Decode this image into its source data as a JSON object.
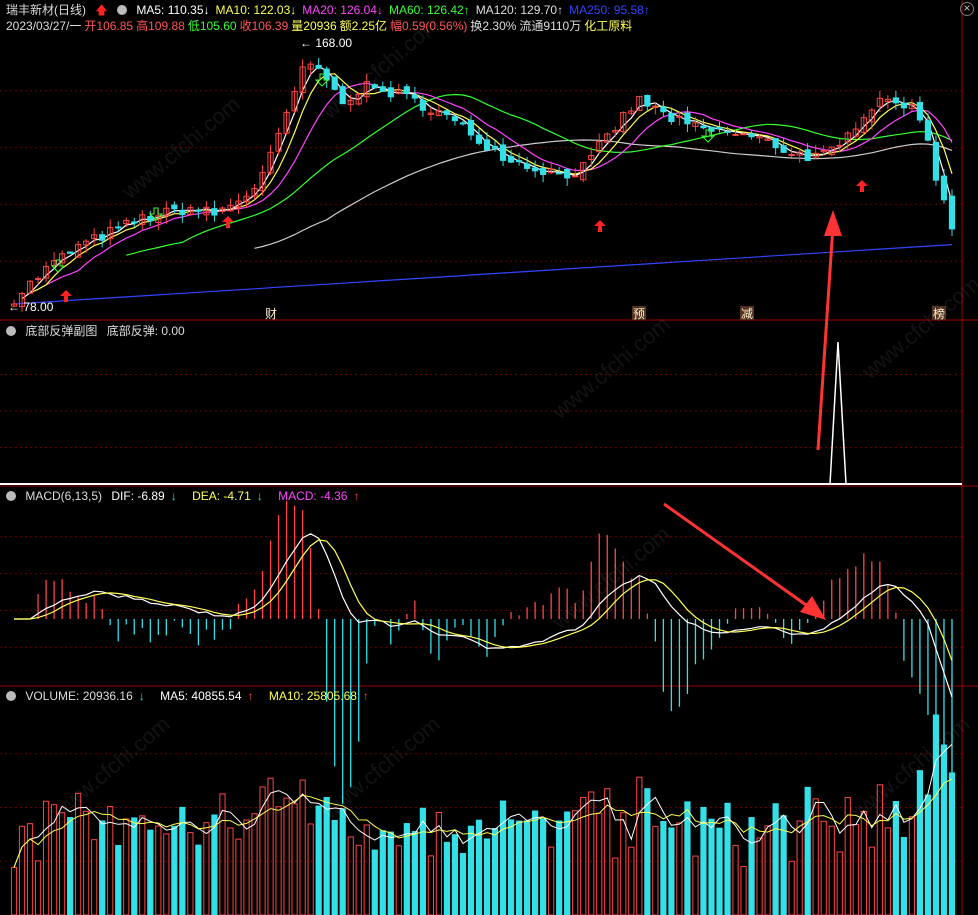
{
  "header": {
    "title": "瑞丰新材(日线)",
    "ma": [
      {
        "label": "MA5: 110.35",
        "color": "#ffffff",
        "dir": "↓"
      },
      {
        "label": "MA10: 122.03",
        "color": "#ffff55",
        "dir": "↓"
      },
      {
        "label": "MA20: 126.04",
        "color": "#ff44ff",
        "dir": "↓"
      },
      {
        "label": "MA60: 126.42",
        "color": "#33ff33",
        "dir": "↑"
      },
      {
        "label": "MA120: 129.70",
        "color": "#dddddd",
        "dir": "↑"
      },
      {
        "label": "MA250: 95.58",
        "color": "#3344ff",
        "dir": "↑"
      }
    ],
    "info": [
      {
        "label": "2023/03/27/一",
        "color": "#dddddd"
      },
      {
        "label": "开106.85",
        "color": "#ff5555"
      },
      {
        "label": "高109.88",
        "color": "#ff5555"
      },
      {
        "label": "低105.60",
        "color": "#33ff33"
      },
      {
        "label": "收106.39",
        "color": "#ff5555"
      },
      {
        "label": "量20936",
        "color": "#ffff55"
      },
      {
        "label": "额2.25亿",
        "color": "#ffff55"
      },
      {
        "label": "幅0.59(0.56%)",
        "color": "#ff5555"
      },
      {
        "label": "换2.30%",
        "color": "#dddddd"
      },
      {
        "label": "流通9110万",
        "color": "#dddddd"
      },
      {
        "label": "化工原料",
        "color": "#ffff55"
      }
    ],
    "high_label": "168.00",
    "low_label": "78.00"
  },
  "markers": [
    "财",
    "预",
    "减",
    "榜"
  ],
  "sub1": {
    "title": "底部反弹副图",
    "value": "底部反弹: 0.00"
  },
  "macd": {
    "title": "MACD(6,13,5)",
    "dif": "DIF: -6.89",
    "dif_dir": "↓",
    "dea": "DEA: -4.71",
    "dea_dir": "↓",
    "macd": "MACD: -4.36",
    "macd_dir": "↑"
  },
  "volume": {
    "title": "VOLUME: 20936.16",
    "title_dir": "↓",
    "ma5": "MA5: 40855.54",
    "ma5_dir": "↑",
    "ma10": "MA10: 25805.68",
    "ma10_dir": "↑"
  },
  "watermark": "www.cfchi.com",
  "colors": {
    "up": "#ff4444",
    "down": "#33e0e8",
    "bg": "#000000",
    "grid": "#5a0000"
  },
  "chart_data": {
    "type": "candlestick",
    "price_range": [
      78,
      168
    ],
    "close_trend": [
      80,
      84,
      88,
      92,
      95,
      98,
      100,
      102,
      104,
      106,
      108,
      109,
      110,
      111,
      112,
      111,
      110,
      112,
      115,
      118,
      125,
      135,
      148,
      160,
      163,
      158,
      150,
      152,
      155,
      154,
      153,
      152,
      150,
      148,
      146,
      143,
      140,
      137,
      134,
      131,
      129,
      127,
      126,
      125,
      124,
      125,
      128,
      135,
      140,
      146,
      150,
      148,
      145,
      143,
      141,
      140,
      139,
      139,
      138,
      137,
      136,
      134,
      132,
      131,
      130,
      131,
      133,
      140,
      146,
      150,
      152,
      149,
      146,
      138,
      118,
      106
    ]
  }
}
